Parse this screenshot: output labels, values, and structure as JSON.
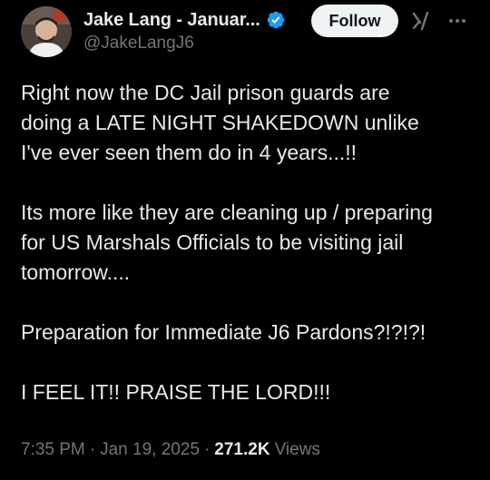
{
  "author": {
    "display_name": "Jake Lang - Januar...",
    "handle": "@JakeLangJ6",
    "verified": true
  },
  "actions": {
    "follow_label": "Follow",
    "grok_icon": "grok-icon",
    "more_icon": "more-icon"
  },
  "tweet": {
    "paragraphs": [
      [
        "Right now the DC Jail prison guards are",
        "doing a LATE NIGHT SHAKEDOWN unlike",
        "I've ever seen them do in 4 years...!!"
      ],
      [
        "Its more like they are cleaning up / preparing",
        "for US Marshals Officials to be visiting jail",
        "tomorrow...."
      ],
      [
        "Preparation for Immediate J6 Pardons?!?!?!"
      ],
      [
        "I FEEL IT!! PRAISE THE LORD!!!"
      ]
    ]
  },
  "meta": {
    "time": "7:35 PM",
    "separator": "·",
    "date": "Jan 19, 2025",
    "views_count": "271.2K",
    "views_label": "Views"
  },
  "colors": {
    "background": "#000000",
    "text": "#e7e9ea",
    "secondary": "#71767b",
    "verified": "#1d9bf0",
    "follow_bg": "#eff3f4"
  }
}
